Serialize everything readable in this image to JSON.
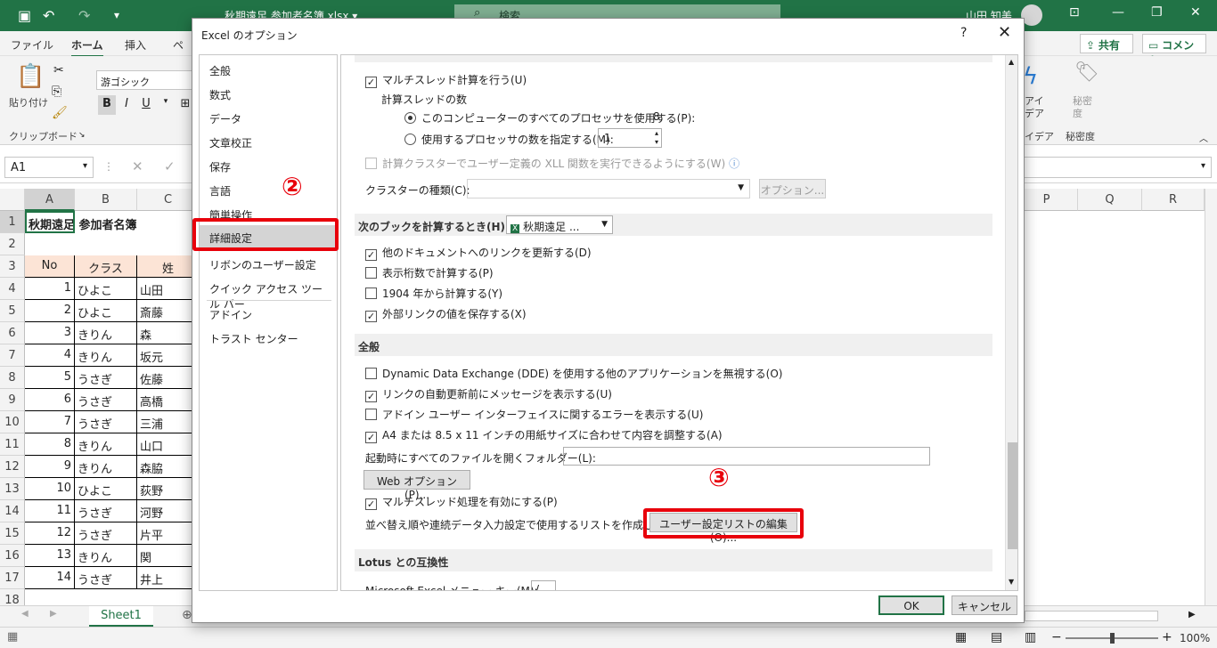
{
  "excel": {
    "doc_title": "秋期遠足 参加者名簿.xlsx ▾",
    "search_placeholder": "検索",
    "user_name": "山田 知美",
    "tabs": [
      "ファイル",
      "ホーム",
      "挿入",
      "ペ"
    ],
    "share_label": "共有",
    "comment_label": "コメント",
    "paste_label": "貼り付け",
    "clipboard_label": "クリップボード",
    "font_name": "游ゴシック",
    "bold": "B",
    "italic": "I",
    "underline": "U",
    "idea_label": "アイ\nデア",
    "idea_group": "イデア",
    "sensitivity_label": "秘密\n度",
    "sensitivity_group": "秘密度",
    "name_box": "A1",
    "columns": [
      "A",
      "B",
      "C",
      "P",
      "Q",
      "R"
    ],
    "rows": [
      "1",
      "2",
      "3",
      "4",
      "5",
      "6",
      "7",
      "8",
      "9",
      "10",
      "11",
      "12",
      "13",
      "14",
      "15",
      "16",
      "17",
      "18"
    ],
    "title_cell": "秋期遠足 参加者名簿",
    "headers": [
      "No",
      "クラス",
      "姓"
    ],
    "data": [
      [
        "1",
        "ひよこ",
        "山田"
      ],
      [
        "2",
        "ひよこ",
        "斎藤"
      ],
      [
        "3",
        "きりん",
        "森"
      ],
      [
        "4",
        "きりん",
        "坂元"
      ],
      [
        "5",
        "うさぎ",
        "佐藤"
      ],
      [
        "6",
        "うさぎ",
        "高橋"
      ],
      [
        "7",
        "うさぎ",
        "三浦"
      ],
      [
        "8",
        "きりん",
        "山口"
      ],
      [
        "9",
        "きりん",
        "森脇"
      ],
      [
        "10",
        "ひよこ",
        "荻野"
      ],
      [
        "11",
        "うさぎ",
        "河野"
      ],
      [
        "12",
        "うさぎ",
        "片平"
      ],
      [
        "13",
        "きりん",
        "関"
      ],
      [
        "14",
        "うさぎ",
        "井上"
      ]
    ],
    "sheet_name": "Sheet1",
    "zoom": "100%"
  },
  "dialog": {
    "title": "Excel のオプション",
    "help": "?",
    "close": "✕",
    "nav": [
      "全般",
      "数式",
      "データ",
      "文章校正",
      "保存",
      "言語",
      "簡単操作",
      "詳細設定",
      "リボンのユーザー設定",
      "クイック アクセス ツール バー",
      "アドイン",
      "トラスト センター"
    ],
    "multithread_calc": "マルチスレッド計算を行う(U)",
    "calc_threads": "計算スレッドの数",
    "use_all_proc": "このコンピューターのすべてのプロセッサを使用する(P):",
    "proc_count": "8",
    "specify_proc": "使用するプロセッサの数を指定する(M):",
    "proc_value": "1",
    "cluster_udf": "計算クラスターでユーザー定義の XLL 関数を実行できるようにする(W)",
    "cluster_type": "クラスターの種類(C):",
    "options_btn": "オプション...",
    "next_book_hdr": "次のブックを計算するとき(H):",
    "book_select": "秋期遠足 ...",
    "update_links": "他のドキュメントへのリンクを更新する(D)",
    "precision": "表示桁数で計算する(P)",
    "date1904": "1904 年から計算する(Y)",
    "save_links": "外部リンクの値を保存する(X)",
    "general_hdr": "全般",
    "dde": "Dynamic Data Exchange (DDE) を使用する他のアプリケーションを無視する(O)",
    "auto_update_msg": "リンクの自動更新前にメッセージを表示する(U)",
    "addin_errors": "アドイン ユーザー インターフェイスに関するエラーを表示する(U)",
    "a4_letter": "A4 または 8.5 x 11 インチの用紙サイズに合わせて内容を調整する(A)",
    "startup_folder": "起動時にすべてのファイルを開くフォルダー(L):",
    "web_options_btn": "Web オプション(P)...",
    "multithread_proc": "マルチスレッド処理を有効にする(P)",
    "custom_list_text": "並べ替え順や連続データ入力設定で使用するリストを作成します:",
    "edit_custom_lists_btn": "ユーザー設定リストの編集(O)...",
    "lotus_hdr": "Lotus との互換性",
    "menu_key": "Microsoft Excel メニュー キー(M):",
    "menu_key_value": "/",
    "ok_btn": "OK",
    "cancel_btn": "キャンセル"
  },
  "annotations": {
    "step2": "②",
    "step3": "③",
    "accent": "#e8000b"
  }
}
